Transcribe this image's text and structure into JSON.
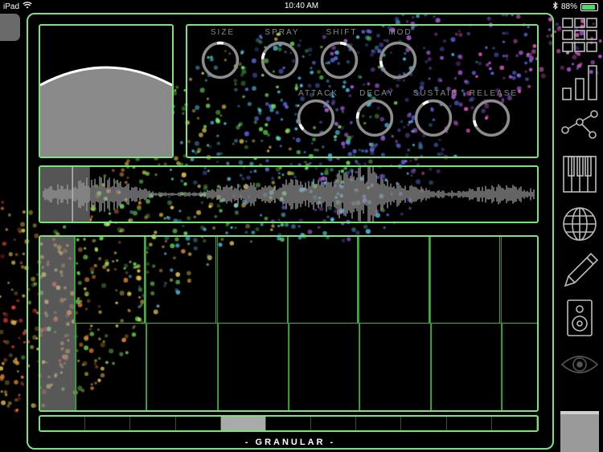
{
  "status_bar": {
    "device": "iPad",
    "time": "10:40 AM",
    "battery": "88%",
    "battery_level": 0.88,
    "wifi_icon": "wifi-icon",
    "bluetooth_icon": "bluetooth-icon"
  },
  "app": {
    "title": "- GRANULAR -",
    "accent_color": "#7ce27c"
  },
  "knobs": {
    "row1": [
      {
        "label": "SIZE",
        "value": 0.5
      },
      {
        "label": "SPRAY",
        "value": 0.22
      },
      {
        "label": "SHIFT",
        "value": 0.55
      },
      {
        "label": "MOD",
        "value": 0.12
      }
    ],
    "row2": [
      {
        "label": "ATTACK",
        "value": 0.05
      },
      {
        "label": "DECAY",
        "value": 0.2
      },
      {
        "label": "SUSTAIN",
        "value": 0.4
      },
      {
        "label": "RELEASE",
        "value": 0.1
      }
    ]
  },
  "waveform": {
    "selection_start": 0.0,
    "selection_end": 0.1,
    "playhead": 0.065
  },
  "keyboard": {
    "white_keys": 7,
    "black_keys": 5,
    "highlighted_key": "white-1"
  },
  "position_bar": {
    "segments": 11,
    "active_segment": 4
  },
  "sidebar": {
    "icons": [
      "grid-icon",
      "bars-icon",
      "network-icon",
      "piano-icon",
      "globe-icon",
      "pencil-icon",
      "speaker-icon",
      "eye-icon",
      "square-icon"
    ]
  }
}
